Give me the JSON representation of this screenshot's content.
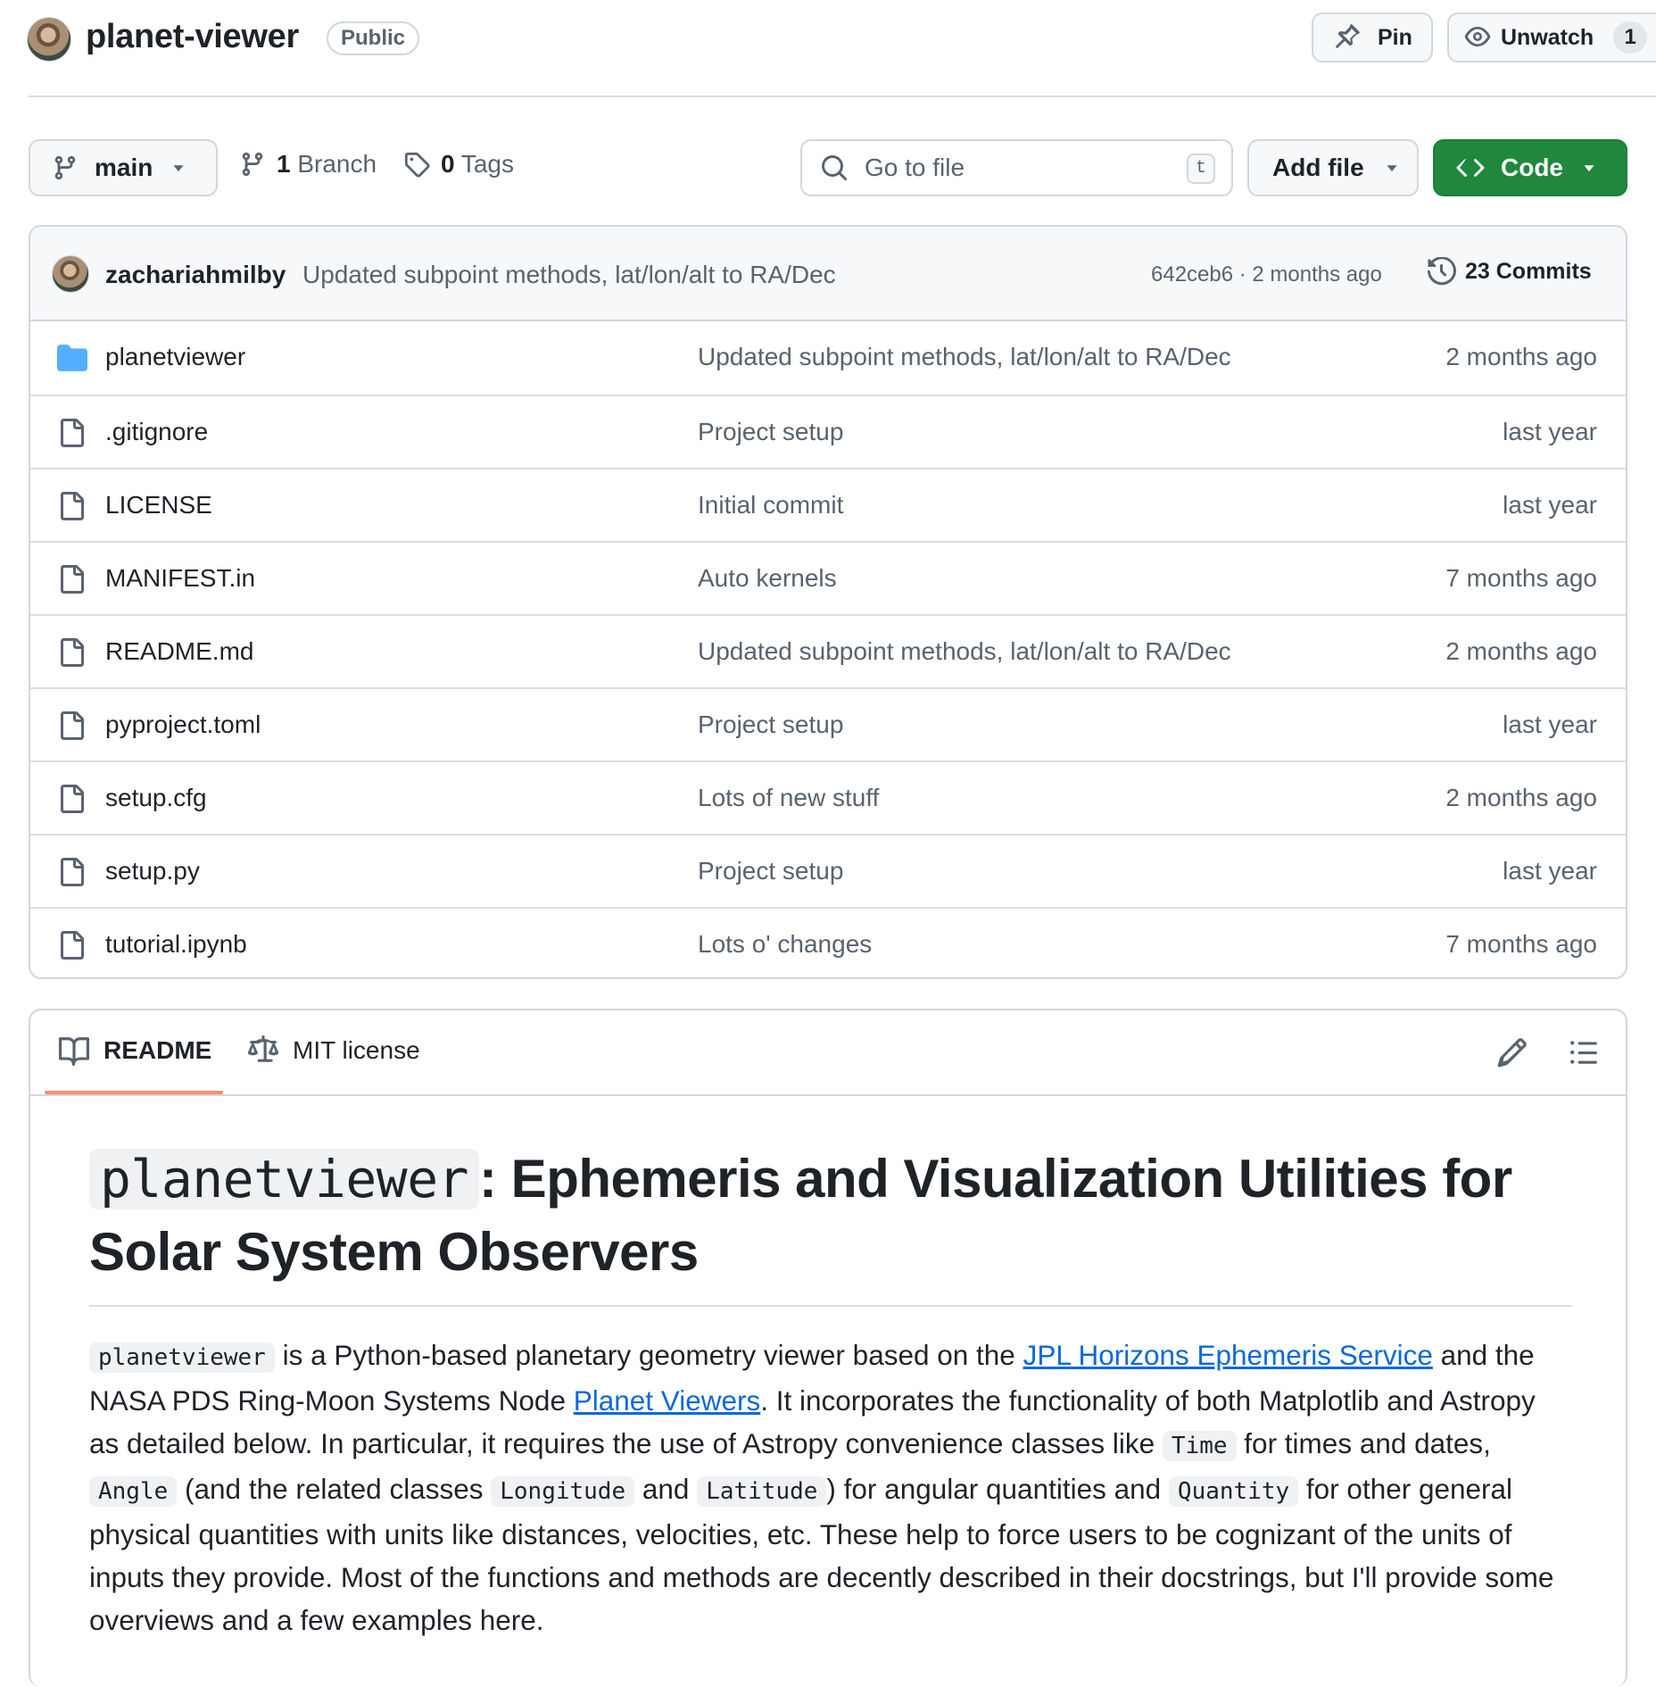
{
  "header": {
    "repo_name": "planet-viewer",
    "visibility": "Public",
    "pin_label": "Pin",
    "watch_label": "Unwatch",
    "watch_count": "1"
  },
  "toolbar": {
    "branch": "main",
    "branch_count": "1",
    "branch_label": "Branch",
    "tag_count": "0",
    "tag_label": "Tags",
    "search_placeholder": "Go to file",
    "search_shortcut": "t",
    "add_file_label": "Add file",
    "code_label": "Code"
  },
  "latest_commit": {
    "author": "zachariahmilby",
    "message": "Updated subpoint methods, lat/lon/alt to RA/Dec",
    "meta": "642ceb6 · 2 months ago",
    "commits_label": "23 Commits"
  },
  "files": [
    {
      "name": "planetviewer",
      "type": "folder",
      "commit": "Updated subpoint methods, lat/lon/alt to RA/Dec",
      "date": "2 months ago"
    },
    {
      "name": ".gitignore",
      "type": "file",
      "commit": "Project setup",
      "date": "last year"
    },
    {
      "name": "LICENSE",
      "type": "file",
      "commit": "Initial commit",
      "date": "last year"
    },
    {
      "name": "MANIFEST.in",
      "type": "file",
      "commit": "Auto kernels",
      "date": "7 months ago"
    },
    {
      "name": "README.md",
      "type": "file",
      "commit": "Updated subpoint methods, lat/lon/alt to RA/Dec",
      "date": "2 months ago"
    },
    {
      "name": "pyproject.toml",
      "type": "file",
      "commit": "Project setup",
      "date": "last year"
    },
    {
      "name": "setup.cfg",
      "type": "file",
      "commit": "Lots of new stuff",
      "date": "2 months ago"
    },
    {
      "name": "setup.py",
      "type": "file",
      "commit": "Project setup",
      "date": "last year"
    },
    {
      "name": "tutorial.ipynb",
      "type": "file",
      "commit": "Lots o' changes",
      "date": "7 months ago"
    }
  ],
  "readme": {
    "tab_readme": "README",
    "tab_license": "MIT license",
    "title_code": "planetviewer",
    "title_rest": ": Ephemeris and Visualization Utilities for Solar System Observers",
    "p": {
      "c1": "planetviewer",
      "t1": " is a Python-based planetary geometry viewer based on the ",
      "l1": "JPL Horizons Ephemeris Service",
      "t2": " and the NASA PDS Ring-Moon Systems Node ",
      "l2": "Planet Viewers",
      "t3": ". It incorporates the functionality of both Matplotlib and Astropy as detailed below. In particular, it requires the use of Astropy convenience classes like ",
      "c2": "Time",
      "t4": " for times and dates, ",
      "c3": "Angle",
      "t5": " (and the related classes ",
      "c4": "Longitude",
      "t6": " and ",
      "c5": "Latitude",
      "t7": ") for angular quantities and ",
      "c6": "Quantity",
      "t8": " for other general physical quantities with units like distances, velocities, etc. These help to force users to be cognizant of the units of inputs they provide. Most of the functions and methods are decently described in their docstrings, but I'll provide some overviews and a few examples here."
    }
  }
}
